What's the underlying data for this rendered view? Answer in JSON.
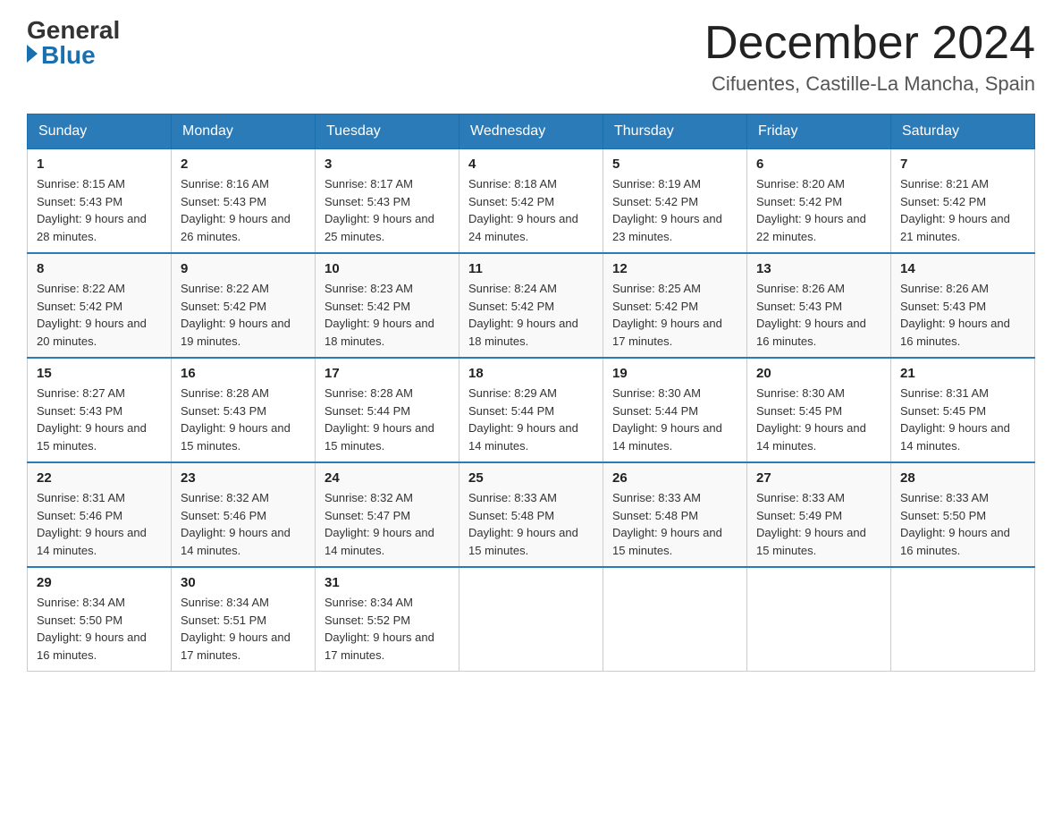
{
  "header": {
    "logo_general": "General",
    "logo_blue": "Blue",
    "month_title": "December 2024",
    "location": "Cifuentes, Castille-La Mancha, Spain"
  },
  "weekdays": [
    "Sunday",
    "Monday",
    "Tuesday",
    "Wednesday",
    "Thursday",
    "Friday",
    "Saturday"
  ],
  "weeks": [
    [
      {
        "day": "1",
        "sunrise": "8:15 AM",
        "sunset": "5:43 PM",
        "daylight": "9 hours and 28 minutes."
      },
      {
        "day": "2",
        "sunrise": "8:16 AM",
        "sunset": "5:43 PM",
        "daylight": "9 hours and 26 minutes."
      },
      {
        "day": "3",
        "sunrise": "8:17 AM",
        "sunset": "5:43 PM",
        "daylight": "9 hours and 25 minutes."
      },
      {
        "day": "4",
        "sunrise": "8:18 AM",
        "sunset": "5:42 PM",
        "daylight": "9 hours and 24 minutes."
      },
      {
        "day": "5",
        "sunrise": "8:19 AM",
        "sunset": "5:42 PM",
        "daylight": "9 hours and 23 minutes."
      },
      {
        "day": "6",
        "sunrise": "8:20 AM",
        "sunset": "5:42 PM",
        "daylight": "9 hours and 22 minutes."
      },
      {
        "day": "7",
        "sunrise": "8:21 AM",
        "sunset": "5:42 PM",
        "daylight": "9 hours and 21 minutes."
      }
    ],
    [
      {
        "day": "8",
        "sunrise": "8:22 AM",
        "sunset": "5:42 PM",
        "daylight": "9 hours and 20 minutes."
      },
      {
        "day": "9",
        "sunrise": "8:22 AM",
        "sunset": "5:42 PM",
        "daylight": "9 hours and 19 minutes."
      },
      {
        "day": "10",
        "sunrise": "8:23 AM",
        "sunset": "5:42 PM",
        "daylight": "9 hours and 18 minutes."
      },
      {
        "day": "11",
        "sunrise": "8:24 AM",
        "sunset": "5:42 PM",
        "daylight": "9 hours and 18 minutes."
      },
      {
        "day": "12",
        "sunrise": "8:25 AM",
        "sunset": "5:42 PM",
        "daylight": "9 hours and 17 minutes."
      },
      {
        "day": "13",
        "sunrise": "8:26 AM",
        "sunset": "5:43 PM",
        "daylight": "9 hours and 16 minutes."
      },
      {
        "day": "14",
        "sunrise": "8:26 AM",
        "sunset": "5:43 PM",
        "daylight": "9 hours and 16 minutes."
      }
    ],
    [
      {
        "day": "15",
        "sunrise": "8:27 AM",
        "sunset": "5:43 PM",
        "daylight": "9 hours and 15 minutes."
      },
      {
        "day": "16",
        "sunrise": "8:28 AM",
        "sunset": "5:43 PM",
        "daylight": "9 hours and 15 minutes."
      },
      {
        "day": "17",
        "sunrise": "8:28 AM",
        "sunset": "5:44 PM",
        "daylight": "9 hours and 15 minutes."
      },
      {
        "day": "18",
        "sunrise": "8:29 AM",
        "sunset": "5:44 PM",
        "daylight": "9 hours and 14 minutes."
      },
      {
        "day": "19",
        "sunrise": "8:30 AM",
        "sunset": "5:44 PM",
        "daylight": "9 hours and 14 minutes."
      },
      {
        "day": "20",
        "sunrise": "8:30 AM",
        "sunset": "5:45 PM",
        "daylight": "9 hours and 14 minutes."
      },
      {
        "day": "21",
        "sunrise": "8:31 AM",
        "sunset": "5:45 PM",
        "daylight": "9 hours and 14 minutes."
      }
    ],
    [
      {
        "day": "22",
        "sunrise": "8:31 AM",
        "sunset": "5:46 PM",
        "daylight": "9 hours and 14 minutes."
      },
      {
        "day": "23",
        "sunrise": "8:32 AM",
        "sunset": "5:46 PM",
        "daylight": "9 hours and 14 minutes."
      },
      {
        "day": "24",
        "sunrise": "8:32 AM",
        "sunset": "5:47 PM",
        "daylight": "9 hours and 14 minutes."
      },
      {
        "day": "25",
        "sunrise": "8:33 AM",
        "sunset": "5:48 PM",
        "daylight": "9 hours and 15 minutes."
      },
      {
        "day": "26",
        "sunrise": "8:33 AM",
        "sunset": "5:48 PM",
        "daylight": "9 hours and 15 minutes."
      },
      {
        "day": "27",
        "sunrise": "8:33 AM",
        "sunset": "5:49 PM",
        "daylight": "9 hours and 15 minutes."
      },
      {
        "day": "28",
        "sunrise": "8:33 AM",
        "sunset": "5:50 PM",
        "daylight": "9 hours and 16 minutes."
      }
    ],
    [
      {
        "day": "29",
        "sunrise": "8:34 AM",
        "sunset": "5:50 PM",
        "daylight": "9 hours and 16 minutes."
      },
      {
        "day": "30",
        "sunrise": "8:34 AM",
        "sunset": "5:51 PM",
        "daylight": "9 hours and 17 minutes."
      },
      {
        "day": "31",
        "sunrise": "8:34 AM",
        "sunset": "5:52 PM",
        "daylight": "9 hours and 17 minutes."
      },
      null,
      null,
      null,
      null
    ]
  ]
}
